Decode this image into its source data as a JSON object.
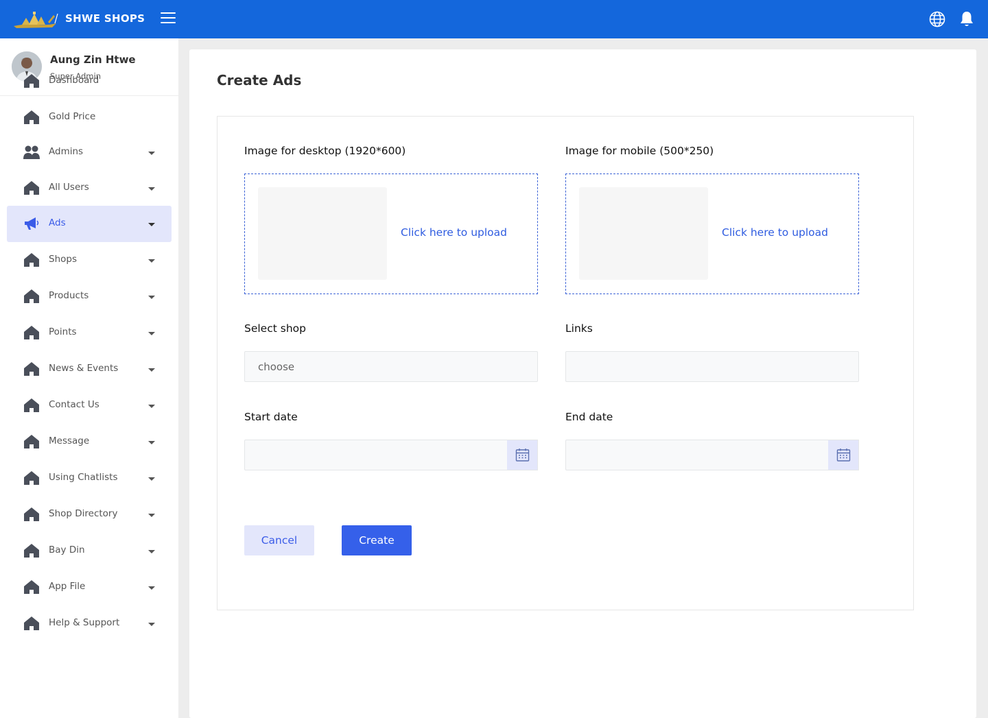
{
  "app": {
    "brand": "SHWE SHOPS"
  },
  "profile": {
    "name": "Aung Zin Htwe",
    "role": "Super Admin"
  },
  "sidebar": {
    "items": [
      {
        "label": "Dashboard",
        "icon": "home-icon"
      },
      {
        "label": "Gold Price",
        "icon": "home-icon"
      },
      {
        "label": "Admins",
        "icon": "users-icon"
      },
      {
        "label": "All Users",
        "icon": "home-icon"
      },
      {
        "label": "Ads",
        "icon": "megaphone-icon",
        "active": true
      },
      {
        "label": "Shops",
        "icon": "home-icon"
      },
      {
        "label": "Products",
        "icon": "home-icon"
      },
      {
        "label": "Points",
        "icon": "home-icon"
      },
      {
        "label": "News & Events",
        "icon": "home-icon"
      },
      {
        "label": "Contact Us",
        "icon": "home-icon"
      },
      {
        "label": "Message",
        "icon": "home-icon"
      },
      {
        "label": "Using Chatlists",
        "icon": "home-icon"
      },
      {
        "label": "Shop Directory",
        "icon": "home-icon"
      },
      {
        "label": "Bay Din",
        "icon": "home-icon"
      },
      {
        "label": "App File",
        "icon": "home-icon"
      },
      {
        "label": "Help & Support",
        "icon": "home-icon"
      }
    ]
  },
  "main": {
    "title": "Create Ads",
    "desktop_image": {
      "label": "Image for desktop (1920*600)",
      "upload_text": "Click here to upload"
    },
    "mobile_image": {
      "label": "Image for mobile (500*250)",
      "upload_text": "Click here to upload"
    },
    "select_shop": {
      "label": "Select shop",
      "placeholder": "choose",
      "value": ""
    },
    "links": {
      "label": "Links",
      "value": ""
    },
    "start_date": {
      "label": "Start date",
      "value": ""
    },
    "end_date": {
      "label": "End date",
      "value": ""
    },
    "cancel_label": "Cancel",
    "create_label": "Create"
  },
  "colors": {
    "topbar": "#1467dc",
    "accent": "#3560ea",
    "active_bg": "#e3e6fb"
  }
}
